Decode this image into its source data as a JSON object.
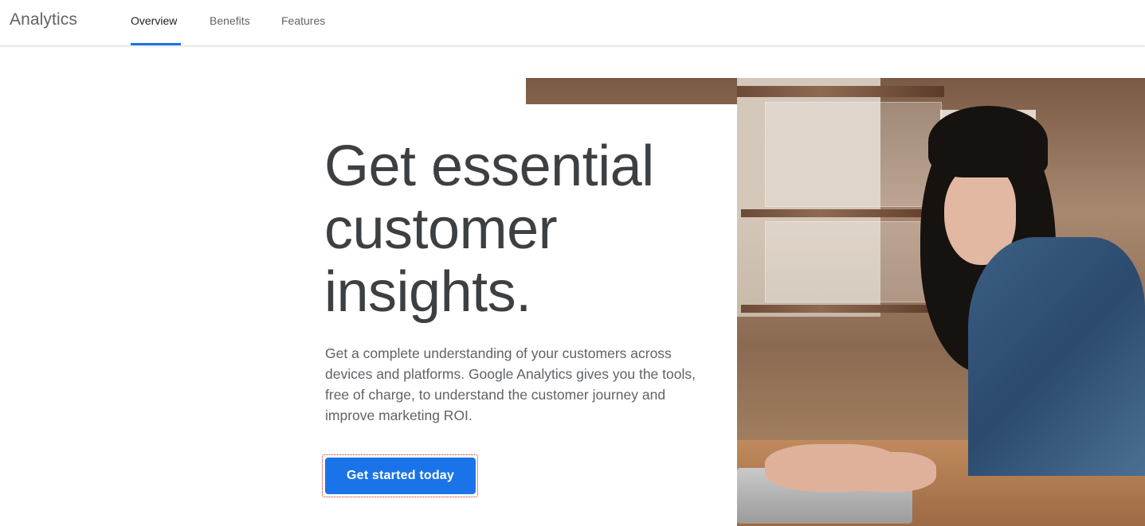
{
  "header": {
    "brand": "Analytics",
    "tabs": [
      {
        "label": "Overview",
        "active": true
      },
      {
        "label": "Benefits",
        "active": false
      },
      {
        "label": "Features",
        "active": false
      }
    ]
  },
  "hero": {
    "headline_lines": [
      "Get essential",
      "customer",
      "insights."
    ],
    "description": "Get a complete understanding of your customers across devices and platforms. Google Analytics gives you the tools, free of charge, to understand the customer journey and improve marketing ROI.",
    "cta_label": "Get started today",
    "image_subject": "woman-using-laptop-in-shop"
  },
  "colors": {
    "accent": "#1a73e8",
    "text_primary": "#3c4043",
    "text_secondary": "#5f6368"
  }
}
